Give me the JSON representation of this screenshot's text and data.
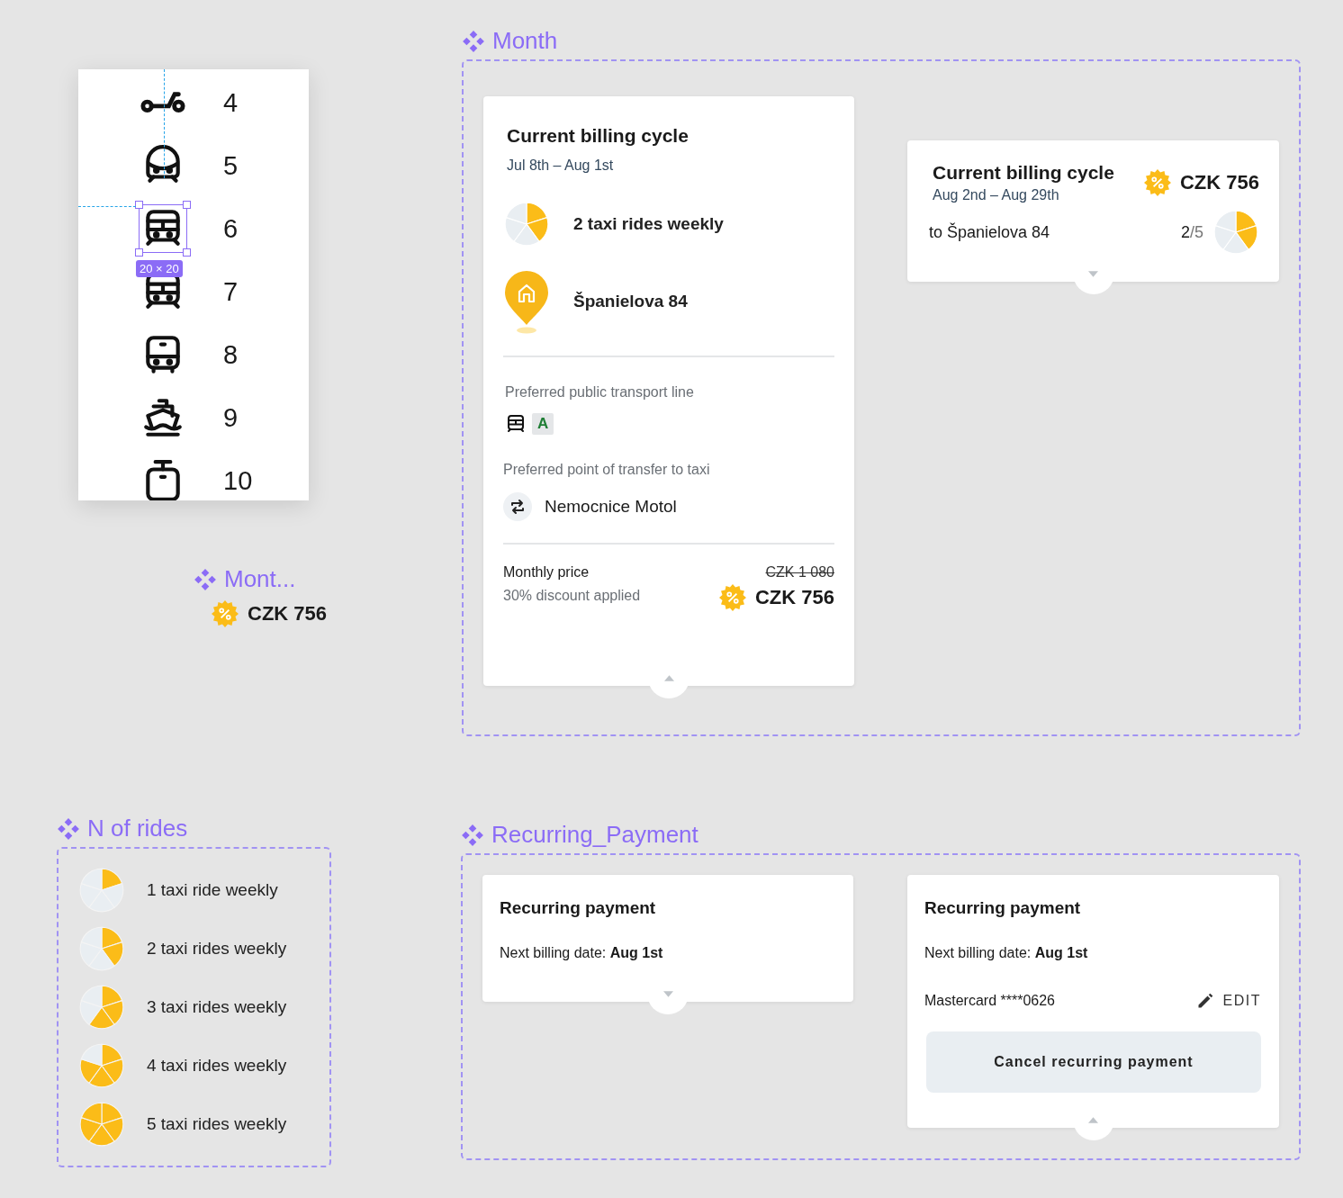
{
  "icon_list": {
    "items": [
      {
        "label": "4",
        "kind": "scooter",
        "selected": false
      },
      {
        "label": "5",
        "kind": "train",
        "selected": false
      },
      {
        "label": "6",
        "kind": "tram",
        "selected": true
      },
      {
        "label": "7",
        "kind": "tram",
        "selected": false
      },
      {
        "label": "8",
        "kind": "bus",
        "selected": false
      },
      {
        "label": "9",
        "kind": "ship",
        "selected": false
      },
      {
        "label": "10",
        "kind": "trolley",
        "selected": false
      }
    ],
    "size_badge": "20 × 20"
  },
  "mini_component": {
    "title": "Mont...",
    "price": "CZK 756"
  },
  "month": {
    "title": "Month",
    "expanded_card": {
      "title": "Current billing cycle",
      "dates": "Jul 8th – Aug 1st",
      "rides": "2 taxi rides weekly",
      "address": "Španielova 84",
      "transport_label": "Preferred public transport line",
      "line": "A",
      "transfer_label": "Preferred point of transfer to taxi",
      "transfer_stop": "Nemocnice Motol",
      "price_label": "Monthly price",
      "discount_note": "30% discount applied",
      "old_price": "CZK 1 080",
      "price": "CZK 756",
      "segments": [
        {
          "filled": true
        },
        {
          "filled": true
        },
        {
          "filled": false
        },
        {
          "filled": false
        },
        {
          "filled": false
        }
      ]
    },
    "collapsed_card": {
      "title": "Current billing cycle",
      "dates": "Aug 2nd – Aug 29th",
      "price": "CZK 756",
      "destination": "to Španielova 84",
      "count": "2",
      "total": "/5",
      "segments": [
        {
          "filled": true
        },
        {
          "filled": true
        },
        {
          "filled": false
        },
        {
          "filled": false
        },
        {
          "filled": false
        }
      ]
    }
  },
  "n_of_rides": {
    "title": "N of rides",
    "items": [
      {
        "label": "1 taxi ride weekly",
        "segments": [
          {
            "filled": true
          },
          {
            "filled": false
          },
          {
            "filled": false
          },
          {
            "filled": false
          },
          {
            "filled": false
          }
        ]
      },
      {
        "label": "2 taxi rides weekly",
        "segments": [
          {
            "filled": true
          },
          {
            "filled": true
          },
          {
            "filled": false
          },
          {
            "filled": false
          },
          {
            "filled": false
          }
        ]
      },
      {
        "label": "3 taxi rides weekly",
        "segments": [
          {
            "filled": true
          },
          {
            "filled": true
          },
          {
            "filled": true
          },
          {
            "filled": false
          },
          {
            "filled": false
          }
        ]
      },
      {
        "label": "4 taxi rides weekly",
        "segments": [
          {
            "filled": true
          },
          {
            "filled": true
          },
          {
            "filled": true
          },
          {
            "filled": true
          },
          {
            "filled": false
          }
        ]
      },
      {
        "label": "5 taxi rides weekly",
        "segments": [
          {
            "filled": true
          },
          {
            "filled": true
          },
          {
            "filled": true
          },
          {
            "filled": true
          },
          {
            "filled": true
          }
        ]
      }
    ]
  },
  "recurring_payment": {
    "title": "Recurring_Payment",
    "cards": [
      {
        "kind": "collapsed",
        "title": "Recurring payment",
        "next_billing": "Next billing date: **Aug 1st**"
      },
      {
        "kind": "expanded",
        "title": "Recurring payment",
        "next_billing": "Next billing date: **Aug 1st**",
        "card": "Mastercard ****0626",
        "edit": "EDIT",
        "cancel": "Cancel recurring payment"
      }
    ]
  }
}
